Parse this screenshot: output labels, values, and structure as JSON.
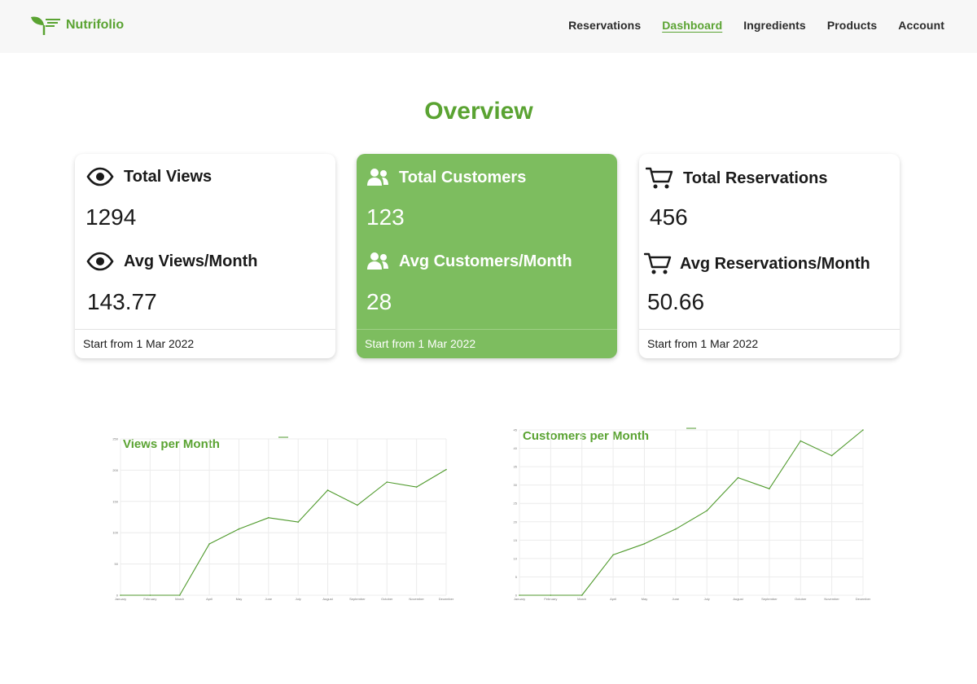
{
  "nav": {
    "brand": "Nutrifolio",
    "links": [
      {
        "label": "Reservations",
        "active": false
      },
      {
        "label": "Dashboard",
        "active": true
      },
      {
        "label": "Ingredients",
        "active": false
      },
      {
        "label": "Products",
        "active": false
      },
      {
        "label": "Account",
        "active": false
      }
    ]
  },
  "page": {
    "title": "Overview"
  },
  "cards": {
    "views": {
      "label1": "Total Views",
      "value1": "1294",
      "label2": "Avg Views/Month",
      "value2": "143.77",
      "footer": "Start from 1 Mar 2022"
    },
    "customers": {
      "label1": "Total Customers",
      "value1": "123",
      "label2": "Avg Customers/Month",
      "value2": "28",
      "footer": "Start from 1 Mar 2022"
    },
    "reservations": {
      "label1": "Total Reservations",
      "value1": "456",
      "label2": "Avg Reservations/Month",
      "value2": "50.66",
      "footer": "Start from 1 Mar 2022"
    }
  },
  "colors": {
    "accent": "#5aa332",
    "card_green": "#7dbd5f",
    "line": "#4f9a2c",
    "grid": "#ececec"
  },
  "chart_data": [
    {
      "type": "line",
      "title": "Views per Month",
      "categories": [
        "January",
        "February",
        "March",
        "April",
        "May",
        "June",
        "July",
        "August",
        "September",
        "October",
        "November",
        "December"
      ],
      "values": [
        0,
        0,
        0,
        82,
        106,
        124,
        117,
        168,
        144,
        181,
        173,
        201
      ],
      "yticks": [
        0,
        50,
        100,
        150,
        200,
        250
      ],
      "ylim": [
        0,
        250
      ],
      "grid": true
    },
    {
      "type": "line",
      "title": "Customers per Month",
      "categories": [
        "January",
        "February",
        "March",
        "April",
        "May",
        "June",
        "July",
        "August",
        "September",
        "October",
        "November",
        "December"
      ],
      "values": [
        0,
        0,
        0,
        11,
        14,
        18,
        23,
        32,
        29,
        42,
        38,
        45
      ],
      "yticks": [
        0,
        5,
        10,
        15,
        20,
        25,
        30,
        35,
        40,
        45
      ],
      "ylim": [
        0,
        45
      ],
      "grid": true
    }
  ]
}
